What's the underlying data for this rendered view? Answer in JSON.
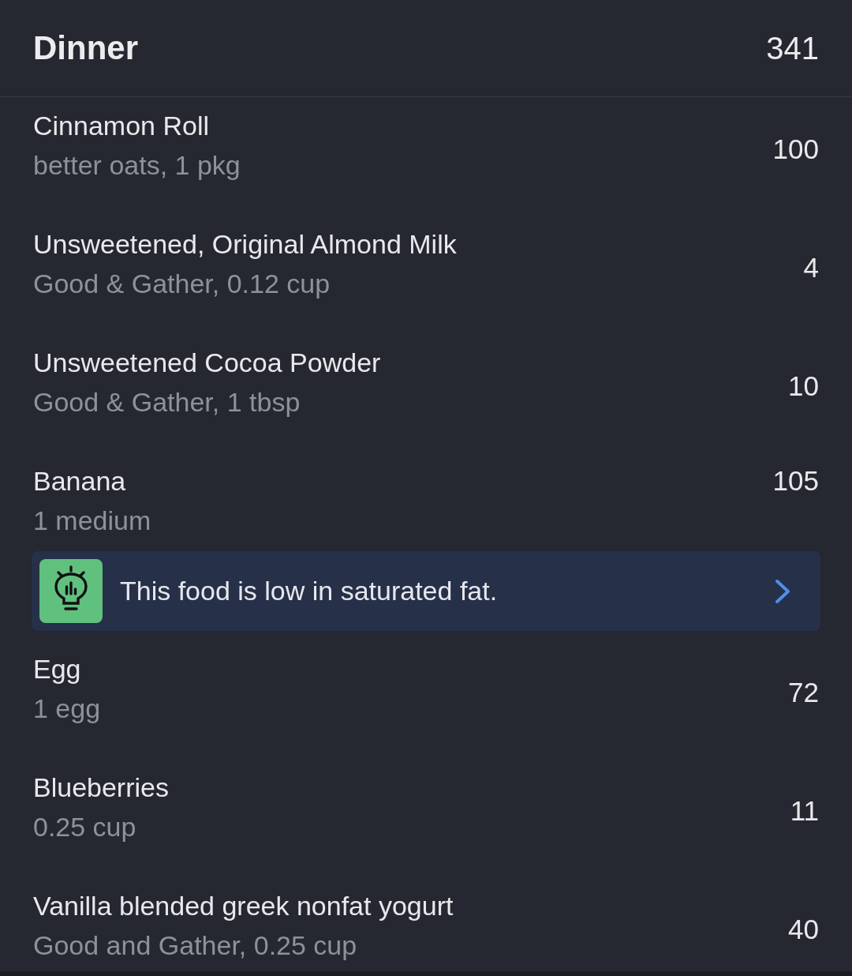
{
  "header": {
    "title": "Dinner",
    "calories": "341"
  },
  "items": [
    {
      "name": "Cinnamon Roll",
      "detail": "better oats, 1 pkg",
      "calories": "100"
    },
    {
      "name": "Unsweetened, Original Almond Milk",
      "detail": "Good & Gather, 0.12 cup",
      "calories": "4"
    },
    {
      "name": "Unsweetened Cocoa Powder",
      "detail": "Good & Gather, 1 tbsp",
      "calories": "10"
    },
    {
      "name": "Banana",
      "detail": "1 medium",
      "calories": "105",
      "tip": {
        "text": "This food is low in saturated fat."
      }
    },
    {
      "name": "Egg",
      "detail": "1 egg",
      "calories": "72"
    },
    {
      "name": "Blueberries",
      "detail": "0.25 cup",
      "calories": "11"
    },
    {
      "name": "Vanilla blended greek nonfat yogurt",
      "detail": "Good and Gather, 0.25 cup",
      "calories": "40"
    }
  ]
}
